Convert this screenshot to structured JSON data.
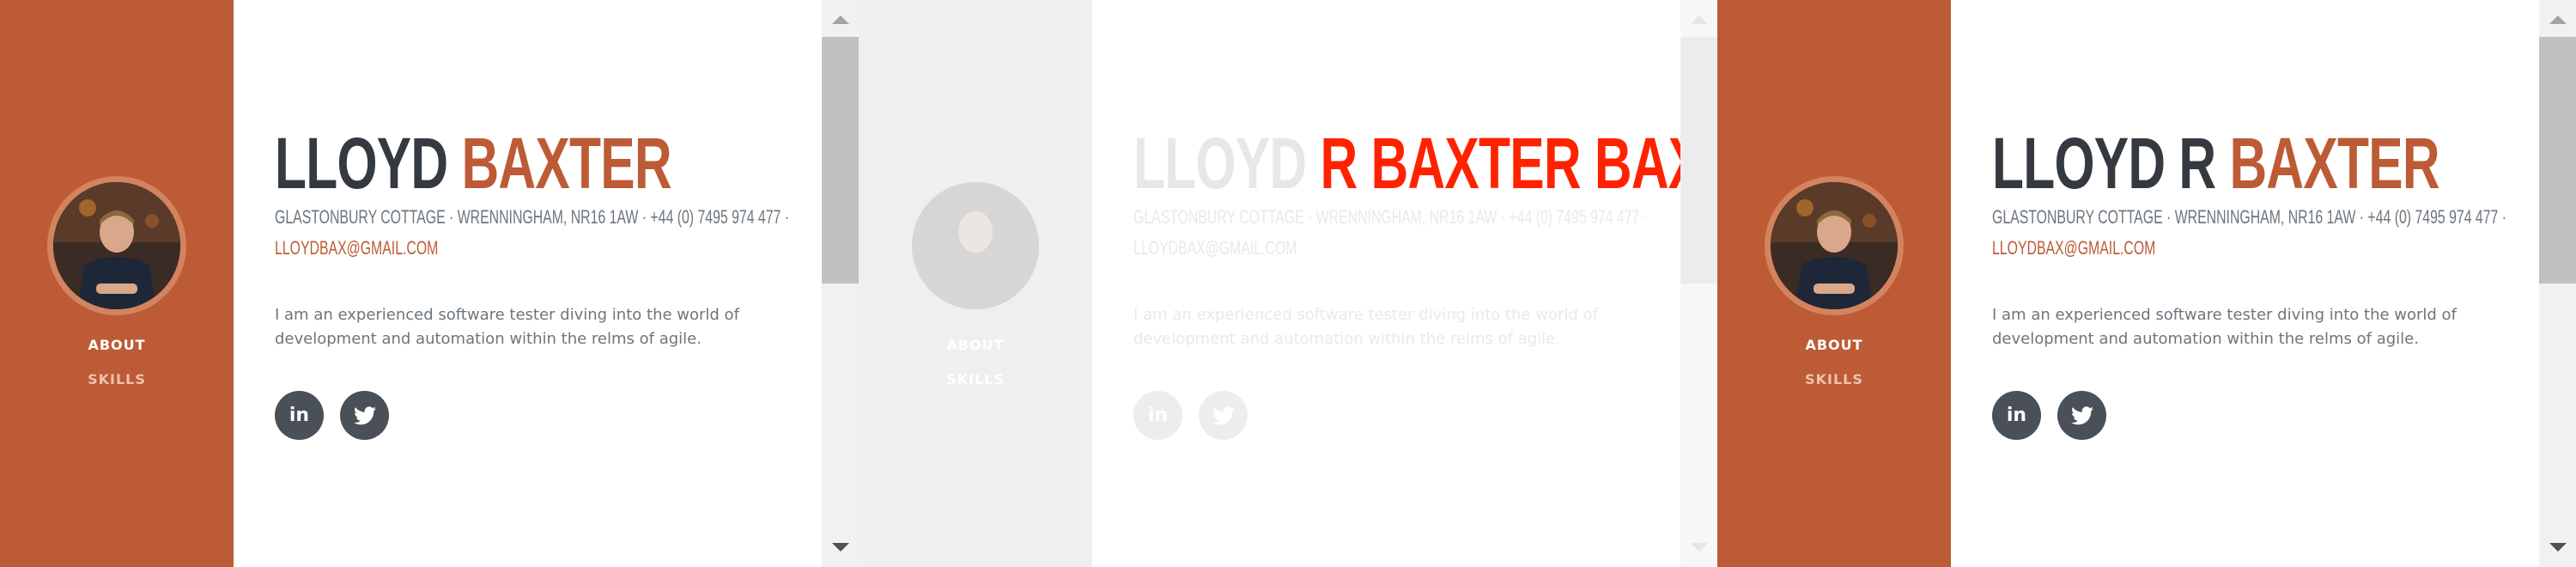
{
  "panels": [
    {
      "nav": {
        "about": "ABOUT",
        "skills": "SKILLS"
      },
      "profile": {
        "first_name": "LLOYD",
        "last_name": "BAXTER",
        "address": "GLASTONBURY COTTAGE · WRENNINGHAM, NR16 1AW · +44 (0) 7495 974 477 ·",
        "email": "LLOYDBAX@GMAIL.COM",
        "bio": "I am an experienced software tester diving into the world of development and automation within the relms of agile."
      },
      "social": {
        "linkedin": "in",
        "twitter": "twitter-icon"
      }
    },
    {
      "nav": {
        "about": "ABOUT",
        "skills": "SKILLS"
      },
      "profile": {
        "first_name": "LLOYD",
        "last_name": "BAXTER",
        "last_name_overlay": "R BAXTER",
        "address": "GLASTONBURY COTTAGE · WRENNINGHAM, NR16 1AW · +44 (0) 7495 974 477 ·",
        "email": "LLOYDBAX@GMAIL.COM",
        "bio": "I am an experienced software tester diving into the world of development and automation within the relms of agile."
      },
      "social": {
        "linkedin": "in",
        "twitter": "twitter-icon"
      }
    },
    {
      "nav": {
        "about": "ABOUT",
        "skills": "SKILLS"
      },
      "profile": {
        "first_name": "LLOYD R",
        "last_name": "BAXTER",
        "address": "GLASTONBURY COTTAGE · WRENNINGHAM, NR16 1AW · +44 (0) 7495 974 477 ·",
        "email": "LLOYDBAX@GMAIL.COM",
        "bio": "I am an experienced software tester diving into the world of development and automation within the relms of agile."
      },
      "social": {
        "linkedin": "in",
        "twitter": "twitter-icon"
      }
    }
  ],
  "colors": {
    "accent": "#bc5b35",
    "text_dark": "#343a40",
    "text_muted": "#6c757d",
    "social_bg": "#495057",
    "diff_red": "#ff2200",
    "diff_yellow": "#ffd200"
  }
}
